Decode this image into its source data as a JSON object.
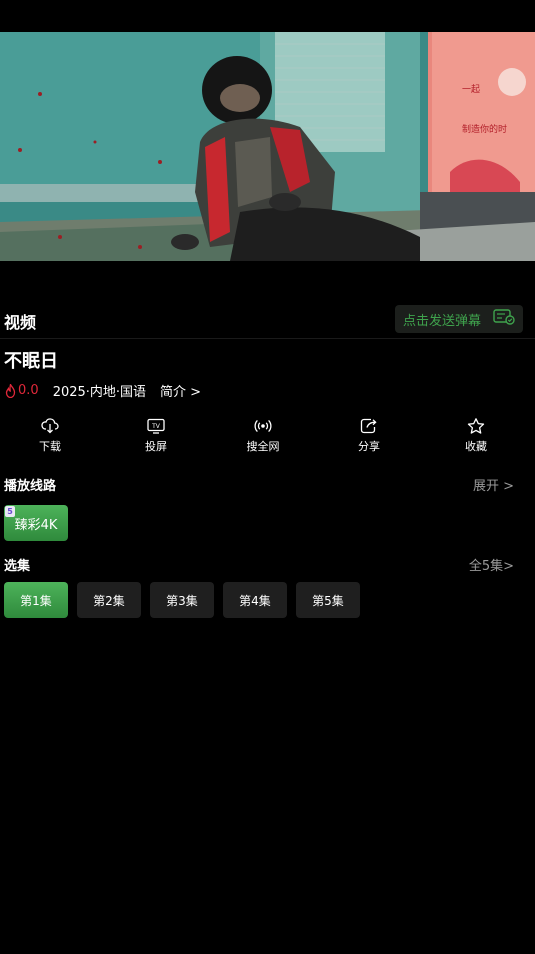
{
  "video": {
    "poster_text": [
      "一起",
      "制造你的时"
    ]
  },
  "tabbar": {
    "title": "视频",
    "danmaku_label": "点击发送弹幕"
  },
  "show": {
    "title": "不眠日",
    "score": "0.0",
    "info": "2025·内地·国语",
    "intro_label": "简介 >"
  },
  "actions": [
    {
      "label": "下载",
      "icon": "download-icon"
    },
    {
      "label": "投屏",
      "icon": "tv-icon"
    },
    {
      "label": "搜全网",
      "icon": "broadcast-icon"
    },
    {
      "label": "分享",
      "icon": "share-icon"
    },
    {
      "label": "收藏",
      "icon": "star-icon"
    }
  ],
  "lines": {
    "label": "播放线路",
    "expand": "展开 >",
    "items": [
      {
        "name": "臻彩4K",
        "badge": "5"
      }
    ]
  },
  "episodes": {
    "label": "选集",
    "total": "全5集>",
    "items": [
      "第1集",
      "第2集",
      "第3集",
      "第4集",
      "第5集"
    ],
    "selected": "第1集"
  },
  "colors": {
    "accent_green": "#3fa34d",
    "score_red": "#e0283a"
  }
}
